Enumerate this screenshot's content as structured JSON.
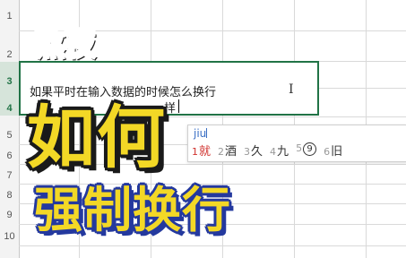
{
  "spreadsheet": {
    "row_numbers": [
      "1",
      "2",
      "3",
      "4",
      "5",
      "6",
      "7",
      "8",
      "9",
      "10"
    ],
    "active_rows": [
      "3",
      "4"
    ],
    "accent_color": "#217346"
  },
  "cell_editor": {
    "line1": "如果平时在输入数据的时候怎么换行",
    "line2": "样"
  },
  "ime": {
    "input": "jiu",
    "candidates": [
      {
        "num": "1",
        "text": "就"
      },
      {
        "num": "2",
        "text": "酒"
      },
      {
        "num": "3",
        "text": "久"
      },
      {
        "num": "4",
        "text": "九"
      },
      {
        "num": "5",
        "text": "9"
      },
      {
        "num": "6",
        "text": "旧"
      }
    ],
    "selected_color": "#d0312d"
  },
  "overlay": {
    "top_text": "熬夜",
    "big_text": "如何",
    "bottom_text": "强制换行",
    "blue": "#1e3fb8",
    "yellow": "#f3d826"
  }
}
